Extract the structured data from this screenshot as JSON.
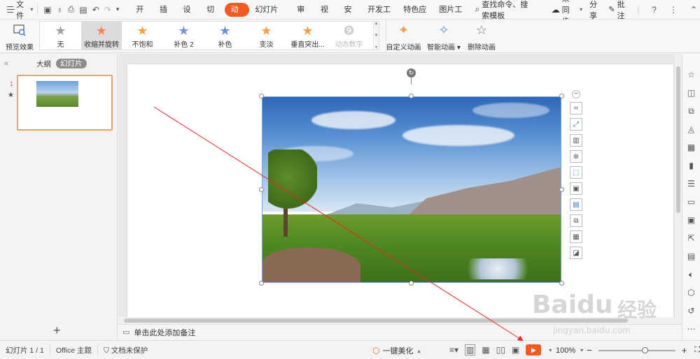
{
  "menubar": {
    "file_label": "文件",
    "tabs": [
      "开始",
      "插入",
      "设计",
      "切换",
      "动画",
      "幻灯片放映",
      "审阅",
      "视图",
      "安全",
      "开发工具",
      "特色应用",
      "图片工具"
    ],
    "active_tab": "动画",
    "search_label": "查找命令、搜索模板",
    "sync_label": "未同步",
    "share_label": "分享",
    "comment_label": "批注"
  },
  "ribbon": {
    "preview_label": "预览效果",
    "gallery": [
      {
        "label": "无",
        "icon": "star-gray-icon",
        "color": "#a0a0a0"
      },
      {
        "label": "收缩并旋转",
        "icon": "star-spin-icon",
        "color": "#f4825c",
        "selected": true
      },
      {
        "label": "不饱和",
        "icon": "star-orange-icon",
        "color": "#f5a04a"
      },
      {
        "label": "补色 2",
        "icon": "star-blue-icon",
        "color": "#7b93d6"
      },
      {
        "label": "补色",
        "icon": "star-gold-blue-icon",
        "color": "#6a8ed8"
      },
      {
        "label": "变淡",
        "icon": "star-fade-icon",
        "color": "#f0a04b"
      },
      {
        "label": "垂直突出...",
        "icon": "star-vertical-icon",
        "color": "#f0a04b"
      },
      {
        "label": "动态数字",
        "icon": "dynamic-number-icon",
        "color": "#cccccc",
        "disabled": true
      }
    ],
    "custom_anim_label": "自定义动画",
    "smart_anim_label": "智能动画",
    "delete_anim_label": "删除动画"
  },
  "leftpanel": {
    "outline_tab": "大纲",
    "slides_tab": "幻灯片",
    "slide_number": "1"
  },
  "notes": {
    "placeholder": "单击此处添加备注"
  },
  "status": {
    "slide_info": "幻灯片 1 / 1",
    "theme": "Office 主题",
    "protection": "文档未保护",
    "beautify": "一键美化",
    "zoom": "100%"
  },
  "watermark": {
    "brand": "Baidu",
    "brand_cn": "经验",
    "url": "jingyan.baidu.com"
  },
  "colors": {
    "accent": "#f15a22",
    "arrow": "#e8271f"
  }
}
